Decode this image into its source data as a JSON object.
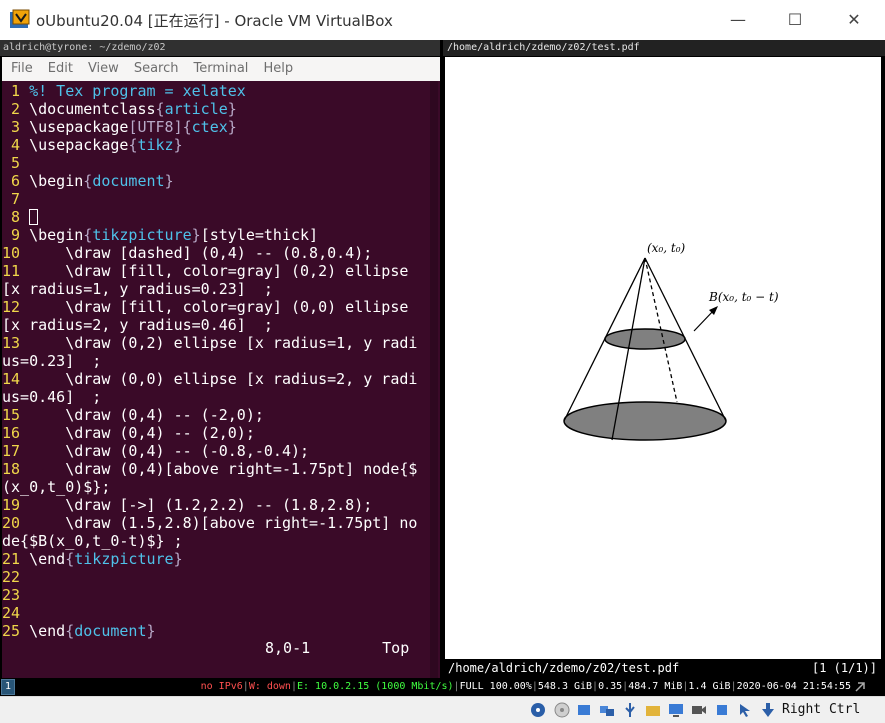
{
  "window": {
    "title": "oUbuntu20.04 [正在运行] - Oracle VM VirtualBox",
    "minimize_icon": "minimize-icon",
    "maximize_icon": "maximize-icon",
    "close_icon": "close-icon"
  },
  "terminal": {
    "title": "aldrich@tyrone: ~/zdemo/z02",
    "menu": [
      "File",
      "Edit",
      "View",
      "Search",
      "Terminal",
      "Help"
    ],
    "lines": [
      {
        "n": "1",
        "segs": [
          [
            "kw",
            "%! Tex program = xelatex"
          ]
        ]
      },
      {
        "n": "2",
        "segs": [
          [
            "t",
            "\\documentclass"
          ],
          [
            "op",
            "{"
          ],
          [
            "kw",
            "article"
          ],
          [
            "op",
            "}"
          ]
        ]
      },
      {
        "n": "3",
        "segs": [
          [
            "t",
            "\\usepackage"
          ],
          [
            "op",
            "[UTF8]{"
          ],
          [
            "kw",
            "ctex"
          ],
          [
            "op",
            "}"
          ]
        ]
      },
      {
        "n": "4",
        "segs": [
          [
            "t",
            "\\usepackage"
          ],
          [
            "op",
            "{"
          ],
          [
            "kw",
            "tikz"
          ],
          [
            "op",
            "}"
          ]
        ]
      },
      {
        "n": "5",
        "segs": []
      },
      {
        "n": "6",
        "segs": [
          [
            "t",
            "\\begin"
          ],
          [
            "op",
            "{"
          ],
          [
            "kw",
            "document"
          ],
          [
            "op",
            "}"
          ]
        ]
      },
      {
        "n": "7",
        "segs": []
      },
      {
        "n": "8",
        "segs": [],
        "cursor": true
      },
      {
        "n": "9",
        "segs": [
          [
            "t",
            "\\begin"
          ],
          [
            "op",
            "{"
          ],
          [
            "kw",
            "tikzpicture"
          ],
          [
            "op",
            "}"
          ],
          [
            "t",
            "[style=thick]"
          ]
        ]
      },
      {
        "n": "10",
        "segs": [
          [
            "t",
            "    \\draw [dashed] (0,4) -- (0.8,0.4);"
          ]
        ]
      },
      {
        "n": "11",
        "segs": [
          [
            "t",
            "    \\draw [fill, color=gray] (0,2) ellipse"
          ]
        ]
      },
      {
        "n": "",
        "segs": [
          [
            "t",
            "[x radius=1, y radius=0.23]  ;"
          ]
        ]
      },
      {
        "n": "12",
        "segs": [
          [
            "t",
            "    \\draw [fill, color=gray] (0,0) ellipse"
          ]
        ]
      },
      {
        "n": "",
        "segs": [
          [
            "t",
            "[x radius=2, y radius=0.46]  ;"
          ]
        ]
      },
      {
        "n": "13",
        "segs": [
          [
            "t",
            "    \\draw (0,2) ellipse [x radius=1, y radi"
          ]
        ]
      },
      {
        "n": "",
        "segs": [
          [
            "t",
            "us=0.23]  ;"
          ]
        ]
      },
      {
        "n": "14",
        "segs": [
          [
            "t",
            "    \\draw (0,0) ellipse [x radius=2, y radi"
          ]
        ]
      },
      {
        "n": "",
        "segs": [
          [
            "t",
            "us=0.46]  ;"
          ]
        ]
      },
      {
        "n": "15",
        "segs": [
          [
            "t",
            "    \\draw (0,4) -- (-2,0);"
          ]
        ]
      },
      {
        "n": "16",
        "segs": [
          [
            "t",
            "    \\draw (0,4) -- (2,0);"
          ]
        ]
      },
      {
        "n": "17",
        "segs": [
          [
            "t",
            "    \\draw (0,4) -- (-0.8,-0.4);"
          ]
        ]
      },
      {
        "n": "18",
        "segs": [
          [
            "t",
            "    \\draw (0,4)[above right=-1.75pt] node{$"
          ]
        ]
      },
      {
        "n": "",
        "segs": [
          [
            "t",
            "(x_0,t_0)$};"
          ]
        ]
      },
      {
        "n": "19",
        "segs": [
          [
            "t",
            "    \\draw [->] (1.2,2.2) -- (1.8,2.8);"
          ]
        ]
      },
      {
        "n": "20",
        "segs": [
          [
            "t",
            "    \\draw (1.5,2.8)[above right=-1.75pt] no"
          ]
        ]
      },
      {
        "n": "",
        "segs": [
          [
            "t",
            "de{$B(x_0,t_0-t)$} ;"
          ]
        ]
      },
      {
        "n": "21",
        "segs": [
          [
            "t",
            "\\end"
          ],
          [
            "op",
            "{"
          ],
          [
            "kw",
            "tikzpicture"
          ],
          [
            "op",
            "}"
          ]
        ]
      },
      {
        "n": "22",
        "segs": []
      },
      {
        "n": "23",
        "segs": []
      },
      {
        "n": "24",
        "segs": []
      },
      {
        "n": "25",
        "segs": [
          [
            "t",
            "\\end"
          ],
          [
            "op",
            "{"
          ],
          [
            "kw",
            "document"
          ],
          [
            "op",
            "}"
          ]
        ]
      }
    ],
    "status_position": "8,0-1",
    "status_scroll": "Top"
  },
  "pdf": {
    "title": "/home/aldrich/zdemo/z02/test.pdf",
    "status_path": "/home/aldrich/zdemo/z02/test.pdf",
    "status_page": "[1 (1/1)]",
    "label_apex": "(x₀, t₀)",
    "label_ball": "B(x₀, t₀ − t)"
  },
  "i3bar": {
    "workspace": "1",
    "ipv6": "no IPv6",
    "wifi": "W: down",
    "eth": "E: 10.0.2.15 (1000 Mbit/s)",
    "battery": "FULL 100.00%",
    "disk": "548.3 GiB",
    "load": "0.35",
    "mem_used": "484.7 MiB",
    "mem_avail": "1.4 GiB",
    "datetime": "2020-06-04 21:54:55"
  },
  "vbox_status": {
    "hostkey": "Right Ctrl"
  },
  "colors": {
    "terminal_bg": "#3a0a28",
    "line_number": "#f0d74a",
    "keyword": "#4fc1e9",
    "workspace": "#285577"
  }
}
